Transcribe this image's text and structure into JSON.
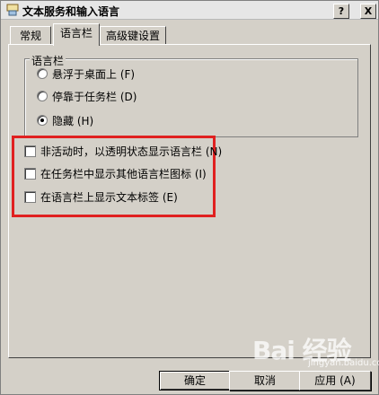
{
  "window": {
    "title": "文本服务和输入语言",
    "help_label": "?",
    "close_label": "X"
  },
  "tabs": [
    {
      "label": "常规",
      "active": false
    },
    {
      "label": "语言栏",
      "active": true
    },
    {
      "label": "高级键设置",
      "active": false
    }
  ],
  "language_bar_group": {
    "title": "语言栏",
    "options": [
      {
        "label": "悬浮于桌面上 (F)",
        "selected": false
      },
      {
        "label": "停靠于任务栏 (D)",
        "selected": false
      },
      {
        "label": "隐藏 (H)",
        "selected": true
      }
    ]
  },
  "checkboxes": [
    {
      "label": "非活动时，以透明状态显示语言栏 (N)",
      "checked": false
    },
    {
      "label": "在任务栏中显示其他语言栏图标 (I)",
      "checked": false
    },
    {
      "label": "在语言栏上显示文本标签 (E)",
      "checked": false
    }
  ],
  "buttons": {
    "ok": "确定",
    "cancel": "取消",
    "apply": "应用 (A)"
  },
  "watermark": {
    "text": "Bai 经验",
    "sub": "jingyan.baidu.com"
  },
  "colors": {
    "highlight": "#e02020",
    "face": "#d4d0c8"
  }
}
